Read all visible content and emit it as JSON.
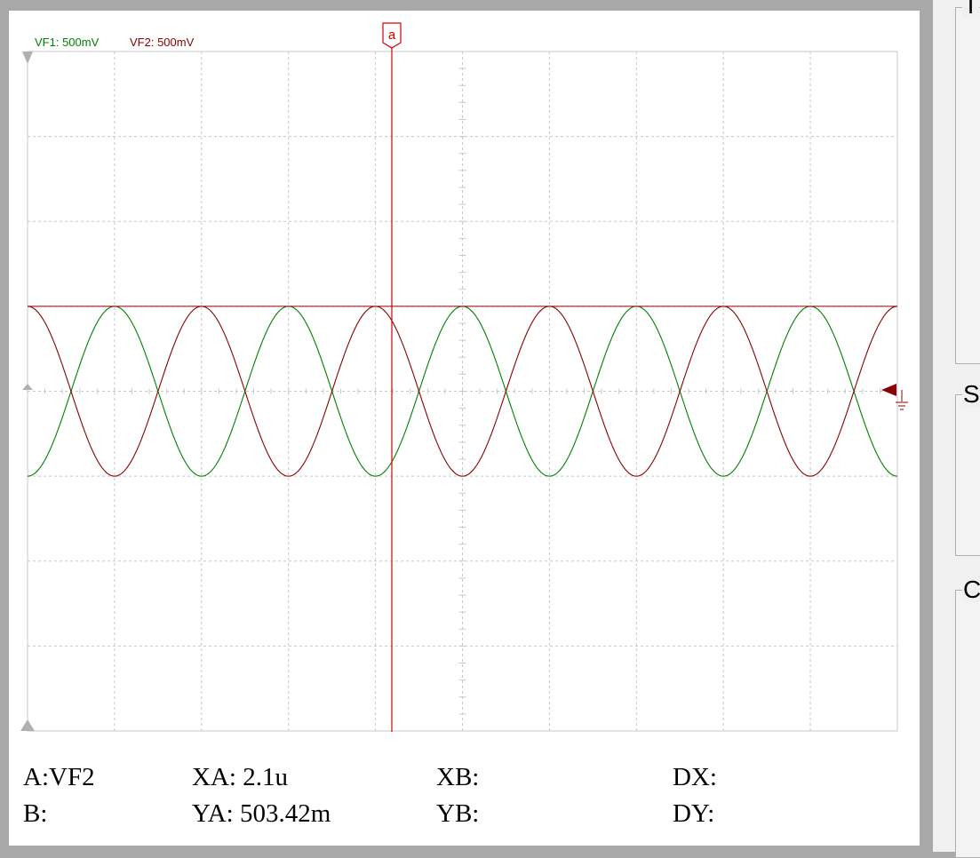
{
  "channels": [
    {
      "name": "VF1",
      "label": "VF1: 500mV",
      "color": "#008000"
    },
    {
      "name": "VF2",
      "label": "VF2: 500mV",
      "color": "#8b0000"
    }
  ],
  "cursor": {
    "label": "a",
    "color": "#d40000"
  },
  "readouts": {
    "a_label": "A:",
    "a_value": "VF2",
    "b_label": "B:",
    "b_value": "",
    "xa_label": "XA:",
    "xa_value": "2.1u",
    "ya_label": "YA:",
    "ya_value": "503.42m",
    "xb_label": "XB:",
    "xb_value": "",
    "yb_label": "YB:",
    "yb_value": "",
    "dx_label": "DX:",
    "dx_value": "",
    "dy_label": "DY:",
    "dy_value": ""
  },
  "side_panel": {
    "group1_letter": "T",
    "group2_letter": "S",
    "group3_letter": "C"
  },
  "chart_data": {
    "type": "line",
    "grid": true,
    "series": [
      {
        "name": "VF1",
        "color": "#008000",
        "waveform": "sine",
        "amplitude_div": 1,
        "offset_div": 0,
        "phase": "starts at minimum"
      },
      {
        "name": "VF2",
        "color": "#8b0000",
        "waveform": "sine",
        "amplitude_div": 1,
        "offset_div": 0,
        "phase": "starts at maximum"
      }
    ],
    "divisions": {
      "x": 10,
      "y": 8
    }
  }
}
